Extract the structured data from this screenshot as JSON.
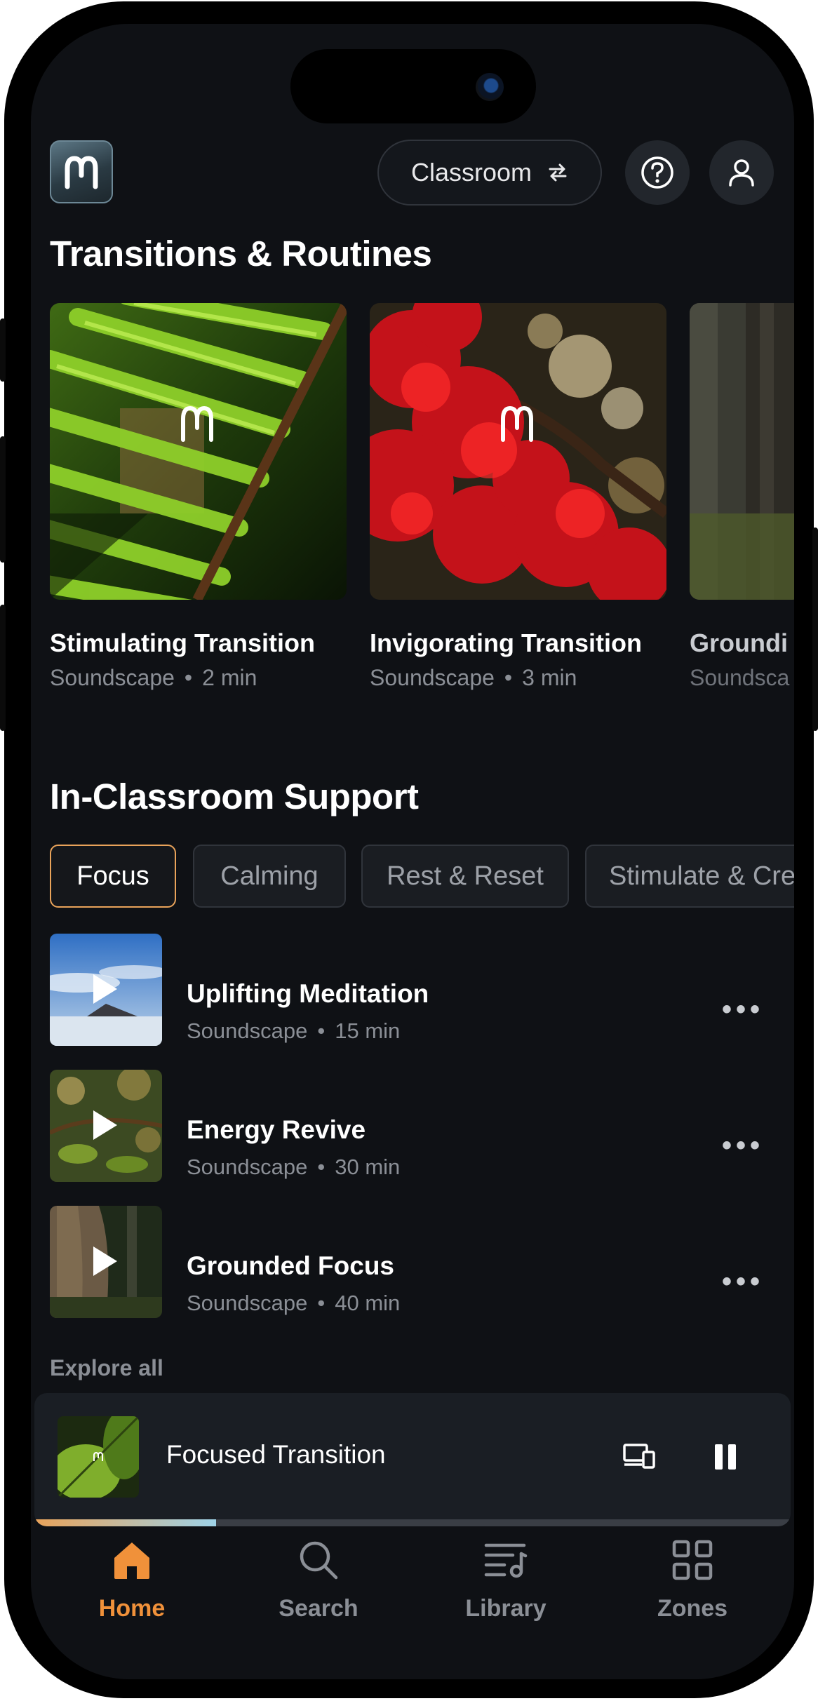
{
  "header": {
    "logo_icon": "brand-logo-icon",
    "location_pill": {
      "label": "Classroom",
      "icon": "swap-arrows-icon"
    },
    "help_icon": "question-circle-icon",
    "profile_icon": "user-icon"
  },
  "transitions": {
    "title": "Transitions & Routines",
    "cards": [
      {
        "title": "Stimulating Transition",
        "type": "Soundscape",
        "duration": "2 min",
        "image": "green palm leaves"
      },
      {
        "title": "Invigorating Transition",
        "type": "Soundscape",
        "duration": "3 min",
        "image": "red maple leaves"
      },
      {
        "title": "Groundi",
        "type": "Soundsca",
        "duration": "",
        "image": "forest trees"
      }
    ]
  },
  "support": {
    "title": "In-Classroom Support",
    "filters": [
      "Focus",
      "Calming",
      "Rest & Reset",
      "Stimulate & Cre"
    ],
    "active_filter": "Focus",
    "items": [
      {
        "title": "Uplifting Meditation",
        "type": "Soundscape",
        "duration": "15 min"
      },
      {
        "title": "Energy Revive",
        "type": "Soundscape",
        "duration": "30 min"
      },
      {
        "title": "Grounded Focus",
        "type": "Soundscape",
        "duration": "40 min"
      }
    ],
    "explore_all": "Explore all"
  },
  "now_playing": {
    "title": "Focused Transition",
    "progress": 0.24,
    "devices_icon": "devices-icon",
    "pause_icon": "pause-icon"
  },
  "tabs": [
    {
      "label": "Home",
      "icon": "home-icon",
      "active": true
    },
    {
      "label": "Search",
      "icon": "search-icon",
      "active": false
    },
    {
      "label": "Library",
      "icon": "library-icon",
      "active": false
    },
    {
      "label": "Zones",
      "icon": "grid-icon",
      "active": false
    }
  ],
  "colors": {
    "accent": "#f0913a",
    "background": "#0f1115",
    "chip_active_border": "#e9a35a"
  }
}
